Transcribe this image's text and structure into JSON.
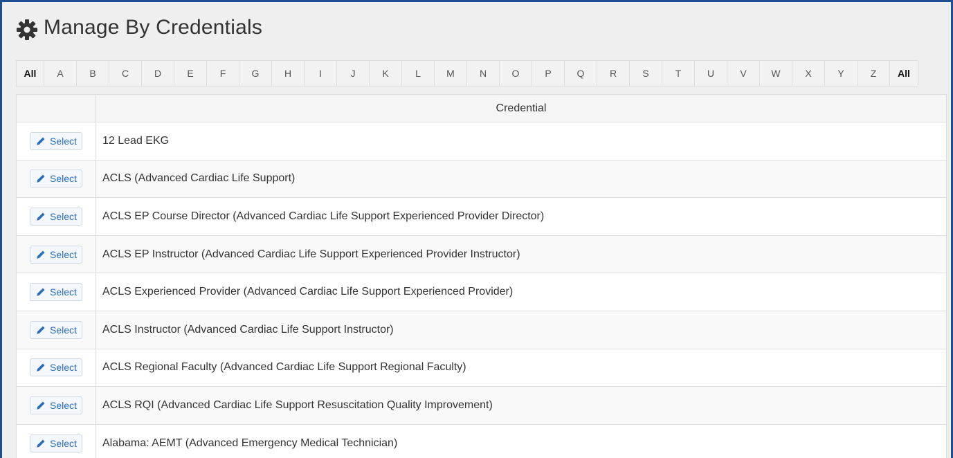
{
  "header": {
    "title": "Manage By Credentials",
    "icon": "gear-icon"
  },
  "alphabet": [
    "All",
    "A",
    "B",
    "C",
    "D",
    "E",
    "F",
    "G",
    "H",
    "I",
    "J",
    "K",
    "L",
    "M",
    "N",
    "O",
    "P",
    "Q",
    "R",
    "S",
    "T",
    "U",
    "V",
    "W",
    "X",
    "Y",
    "Z",
    "All"
  ],
  "table": {
    "column_header": "Credential",
    "select_label": "Select",
    "rows": [
      "12 Lead EKG",
      "ACLS (Advanced Cardiac Life Support)",
      "ACLS EP Course Director (Advanced Cardiac Life Support Experienced Provider Director)",
      "ACLS EP Instructor (Advanced Cardiac Life Support Experienced Provider Instructor)",
      "ACLS Experienced Provider (Advanced Cardiac Life Support Experienced Provider)",
      "ACLS Instructor (Advanced Cardiac Life Support Instructor)",
      "ACLS Regional Faculty (Advanced Cardiac Life Support Regional Faculty)",
      "ACLS RQI (Advanced Cardiac Life Support Resuscitation Quality Improvement)",
      "Alabama: AEMT (Advanced Emergency Medical Technician)"
    ]
  },
  "colors": {
    "border_accent": "#1d4f91",
    "link": "#2a6ebb"
  }
}
